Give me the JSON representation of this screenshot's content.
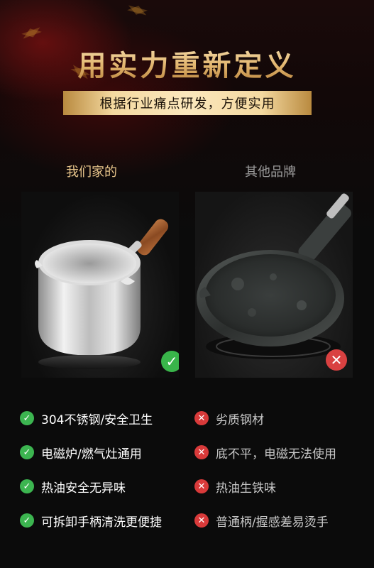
{
  "header": {
    "headline": "用实力重新定义",
    "subtitle": "根据行业痛点研发，方便实用"
  },
  "comparison": {
    "ours_label": "我们家的",
    "theirs_label": "其他品牌",
    "ours_badge_icon": "check-icon",
    "theirs_badge_icon": "cross-icon",
    "ours_features": [
      "304不锈钢/安全卫生",
      "电磁炉/燃气灶通用",
      "热油安全无异味",
      "可拆卸手柄清洗更便捷"
    ],
    "theirs_features": [
      "劣质钢材",
      "底不平，电磁无法使用",
      "热油生铁味",
      "普通柄/握感差易烫手"
    ]
  },
  "colors": {
    "gold": "#e2b66f",
    "check_green": "#3cb550",
    "cross_red": "#d93a3a",
    "background": "#0b0b0b"
  }
}
